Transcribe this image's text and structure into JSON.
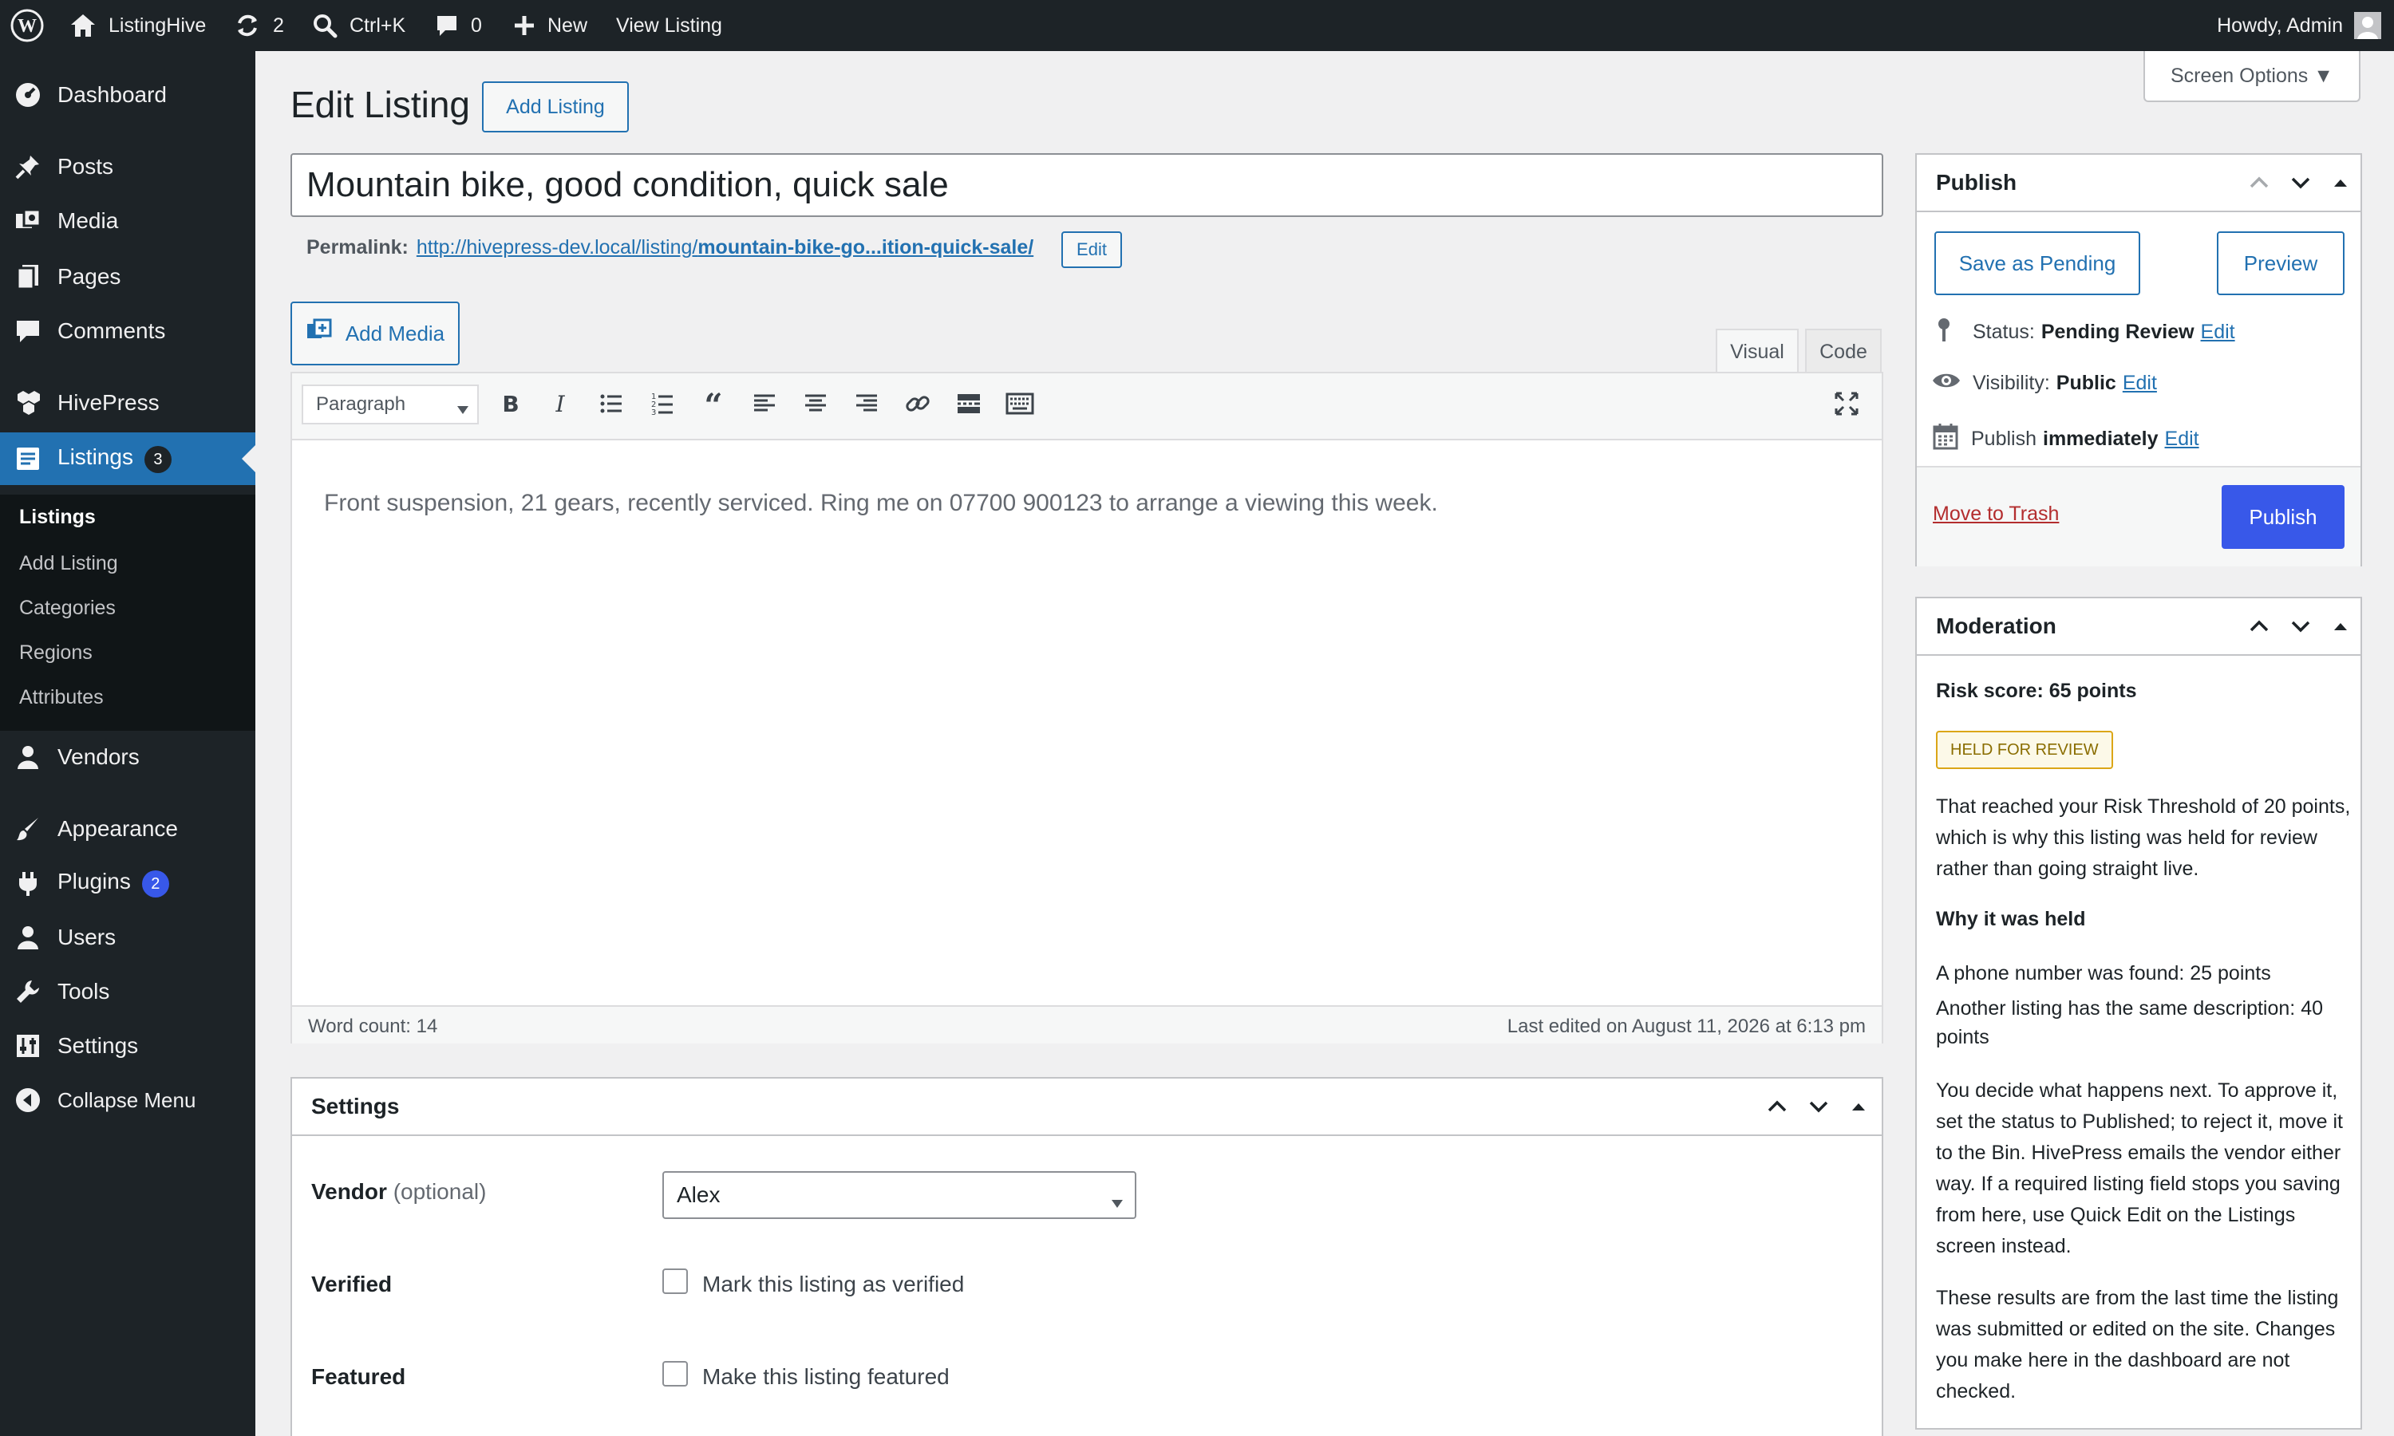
{
  "admin_bar": {
    "site_name": "ListingHive",
    "updates_count": "2",
    "search_shortcut": "Ctrl+K",
    "comments_count": "0",
    "new_label": "New",
    "view_listing": "View Listing",
    "greeting": "Howdy, Admin"
  },
  "sidebar": {
    "dashboard": "Dashboard",
    "posts": "Posts",
    "media": "Media",
    "pages": "Pages",
    "comments": "Comments",
    "hivepress": "HivePress",
    "listings": "Listings",
    "listings_badge": "3",
    "submenu": {
      "listings": "Listings",
      "add_listing": "Add Listing",
      "categories": "Categories",
      "regions": "Regions",
      "attributes": "Attributes"
    },
    "vendors": "Vendors",
    "appearance": "Appearance",
    "plugins": "Plugins",
    "plugins_badge": "2",
    "users": "Users",
    "tools": "Tools",
    "settings": "Settings",
    "collapse": "Collapse Menu"
  },
  "header": {
    "title": "Edit Listing",
    "add_button": "Add Listing",
    "screen_options": "Screen Options ▼"
  },
  "post": {
    "title": "Mountain bike, good condition, quick sale",
    "permalink_label": "Permalink:",
    "permalink_base": "http://hivepress-dev.local/listing/",
    "permalink_slug": "mountain-bike-go...ition-quick-sale/",
    "permalink_edit": "Edit"
  },
  "editor": {
    "add_media": "Add Media",
    "tab_visual": "Visual",
    "tab_code": "Code",
    "format_select": "Paragraph",
    "content": "Front suspension, 21 gears, recently serviced. Ring me on 07700 900123 to arrange a viewing this week.",
    "word_count": "Word count: 14",
    "last_edited": "Last edited on August 11, 2026 at 6:13 pm"
  },
  "settings_box": {
    "title": "Settings",
    "vendor_label": "Vendor",
    "vendor_optional": "(optional)",
    "vendor_value": "Alex",
    "verified_label": "Verified",
    "verified_checkbox": "Mark this listing as verified",
    "featured_label": "Featured",
    "featured_checkbox": "Make this listing featured"
  },
  "publish_box": {
    "title": "Publish",
    "save_pending": "Save as Pending",
    "preview": "Preview",
    "status_label": "Status:",
    "status_value": "Pending Review",
    "visibility_label": "Visibility:",
    "visibility_value": "Public",
    "publish_label": "Publish",
    "publish_value": "immediately",
    "edit": "Edit",
    "trash": "Move to Trash",
    "publish_button": "Publish"
  },
  "moderation_box": {
    "title": "Moderation",
    "risk_score": "Risk score: 65 points",
    "held_badge": "HELD FOR REVIEW",
    "threshold_text": "That reached your Risk Threshold of 20 points, which is why this listing was held for review rather than going straight live.",
    "why_heading": "Why it was held",
    "reason_1": "A phone number was found: 25 points",
    "reason_2": "Another listing has the same description: 40 points",
    "next_text": "You decide what happens next. To approve it, set the status to Published; to reject it, move it to the Bin. HivePress emails the vendor either way. If a required listing field stops you saving from here, use Quick Edit on the Listings screen instead.",
    "results_text": "These results are from the last time the listing was submitted or edited on the site. Changes you make here in the dashboard are not checked."
  },
  "colors": {
    "admin_dark": "#1d2327",
    "accent": "#2271b1",
    "publish_blue": "#3858e9",
    "trash_red": "#b32d2e",
    "held_badge": "#dba617"
  }
}
